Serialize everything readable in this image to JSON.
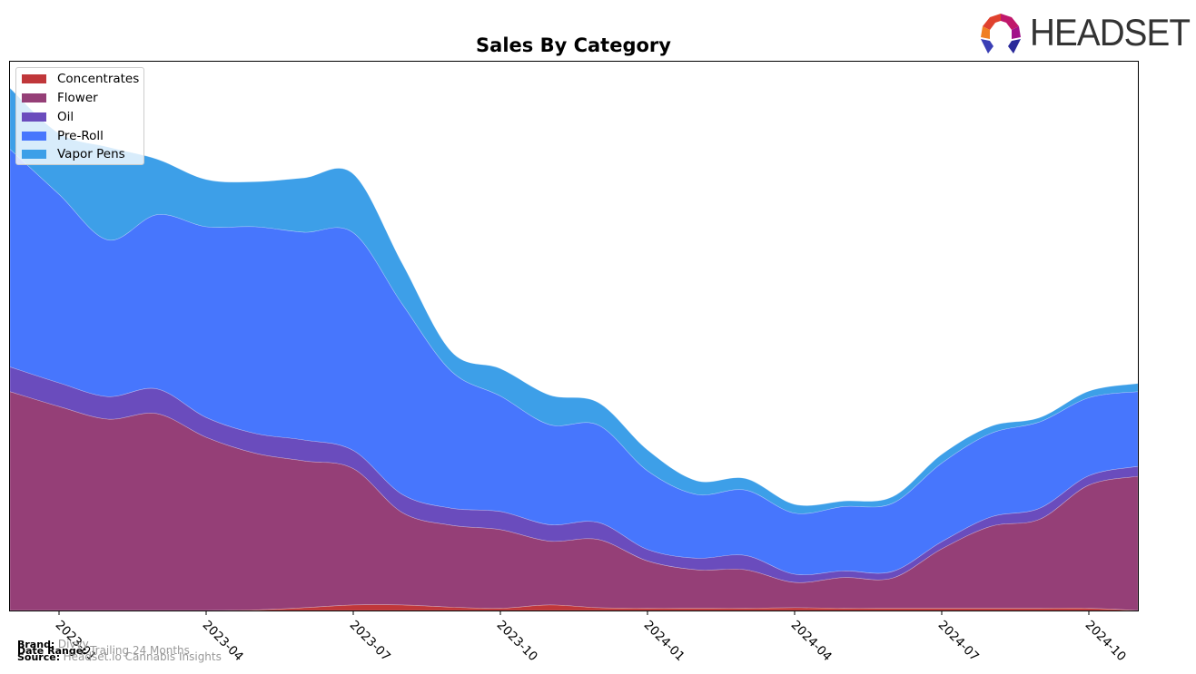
{
  "header": {
    "logo_text": "HEADSET"
  },
  "footer": {
    "brand_label": "Brand:",
    "brand_value": "Divvy",
    "date_range_label": "Date Range:",
    "date_range_value": "Trailing 24 Months",
    "source_label": "Source:",
    "source_value": "Headset.io Cannabis Insights"
  },
  "chart_data": {
    "type": "area",
    "stacked": true,
    "smoothed": true,
    "title": "Sales By Category",
    "xlabel": "",
    "ylabel": "",
    "y_axis_visible": false,
    "grid": false,
    "legend_position": "top-left",
    "x": [
      "2022-12",
      "2023-01",
      "2023-02",
      "2023-03",
      "2023-04",
      "2023-05",
      "2023-06",
      "2023-07",
      "2023-08",
      "2023-09",
      "2023-10",
      "2023-11",
      "2023-12",
      "2024-01",
      "2024-02",
      "2024-03",
      "2024-04",
      "2024-05",
      "2024-06",
      "2024-07",
      "2024-08",
      "2024-09",
      "2024-10",
      "2024-11"
    ],
    "x_tick_labels": [
      "2023-01",
      "2023-04",
      "2023-07",
      "2023-10",
      "2024-01",
      "2024-04",
      "2024-07",
      "2024-10"
    ],
    "ylim": [
      0,
      100
    ],
    "series": [
      {
        "name": "Concentrates",
        "color": "#c0373a",
        "values": [
          0.0,
          0.0,
          0.0,
          0.0,
          0.0,
          0.1,
          0.5,
          1.0,
          1.0,
          0.6,
          0.4,
          1.0,
          0.5,
          0.4,
          0.4,
          0.4,
          0.5,
          0.4,
          0.4,
          0.4,
          0.4,
          0.4,
          0.4,
          0.0
        ]
      },
      {
        "name": "Flower",
        "color": "#953f77",
        "values": [
          39.8,
          37.1,
          34.8,
          35.8,
          31.5,
          28.5,
          26.7,
          24.8,
          16.8,
          14.9,
          14.3,
          11.6,
          12.4,
          8.6,
          7.0,
          7.0,
          4.6,
          5.6,
          5.5,
          10.8,
          14.9,
          16.2,
          22.4,
          24.4
        ]
      },
      {
        "name": "Oil",
        "color": "#6a4cbd",
        "values": [
          4.5,
          4.3,
          4.1,
          4.5,
          3.6,
          3.6,
          3.8,
          3.3,
          3.3,
          3.1,
          3.3,
          3.0,
          3.1,
          2.1,
          2.1,
          2.6,
          1.5,
          1.2,
          1.2,
          1.3,
          1.7,
          2.0,
          1.7,
          1.8
        ]
      },
      {
        "name": "Pre-Roll",
        "color": "#4776fd",
        "values": [
          39.6,
          34.3,
          28.5,
          31.7,
          34.7,
          37.6,
          37.8,
          39.6,
          34.6,
          24.9,
          21.0,
          18.2,
          17.7,
          14.3,
          11.6,
          11.9,
          11.1,
          11.7,
          12.4,
          14.3,
          15.2,
          15.7,
          14.2,
          13.6
        ]
      },
      {
        "name": "Vapor Pens",
        "color": "#3d9fe8",
        "values": [
          11.1,
          11.1,
          16.9,
          10.1,
          8.6,
          8.2,
          9.9,
          10.7,
          7.4,
          3.6,
          5.0,
          5.4,
          4.1,
          3.8,
          2.5,
          2.1,
          1.6,
          1.0,
          1.2,
          1.6,
          1.3,
          0.8,
          1.2,
          1.5
        ]
      }
    ]
  }
}
